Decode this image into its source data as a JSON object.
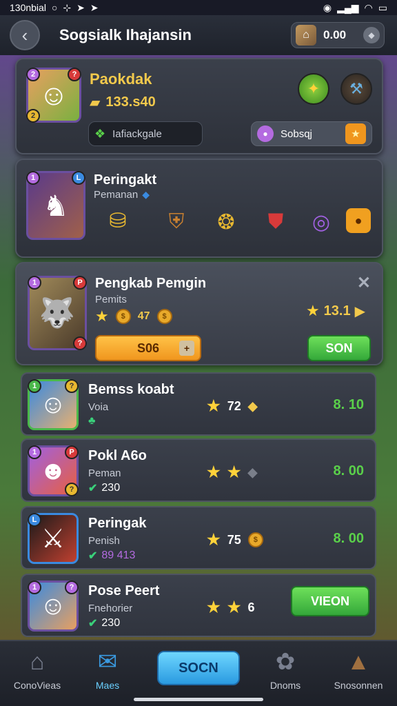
{
  "status_bar": {
    "left_text": "130nbial",
    "icons": [
      "circle-icon",
      "grid-icon",
      "send-icon",
      "send-icon"
    ]
  },
  "header": {
    "title": "Sogsialk Ihajansin",
    "currency_value": "0.00",
    "currency_badge": "!"
  },
  "card1": {
    "name": "Paokdak",
    "value": "133.s40",
    "input_placeholder": "Iafiackgale",
    "pill_label": "Sobsqj",
    "badge_left": "2",
    "badge_right": "?",
    "badge_bottom": "2"
  },
  "card2": {
    "name": "Peringakt",
    "sub": "Pemanan",
    "badge_left": "1",
    "badge_right": "L"
  },
  "card3": {
    "name": "Pengkab Pemgin",
    "sub": "Pemits",
    "coin_value": "47",
    "star_value": "13.1",
    "orange_button": "S06",
    "green_button": "SON",
    "badge_left": "1",
    "badge_right": "P",
    "badge_bottom": "?"
  },
  "rows": [
    {
      "title": "Bemss koabt",
      "sub": "Voia",
      "score": "",
      "star_value": "72",
      "right_value": "8. 10",
      "button": ""
    },
    {
      "title": "Pokl A6o",
      "sub": "Peman",
      "score": "230",
      "star_value": "",
      "right_value": "8. 00",
      "button": ""
    },
    {
      "title": "Peringak",
      "sub": "Penish",
      "score": "89 413",
      "star_value": "75",
      "right_value": "8. 00",
      "button": ""
    },
    {
      "title": "Pose Peert",
      "sub": "Fnehorier",
      "score": "230",
      "star_value": "6",
      "right_value": "",
      "button": "VIEON"
    }
  ],
  "bottom_nav": {
    "items": [
      "ConoVieas",
      "Maes",
      "Dnoms",
      "Snosonnen"
    ],
    "center_button": "SOCN"
  },
  "colors": {
    "gold": "#f2c94c",
    "green": "#5ad04a",
    "accent_blue": "#2a9ae0",
    "orange": "#f0961e"
  }
}
